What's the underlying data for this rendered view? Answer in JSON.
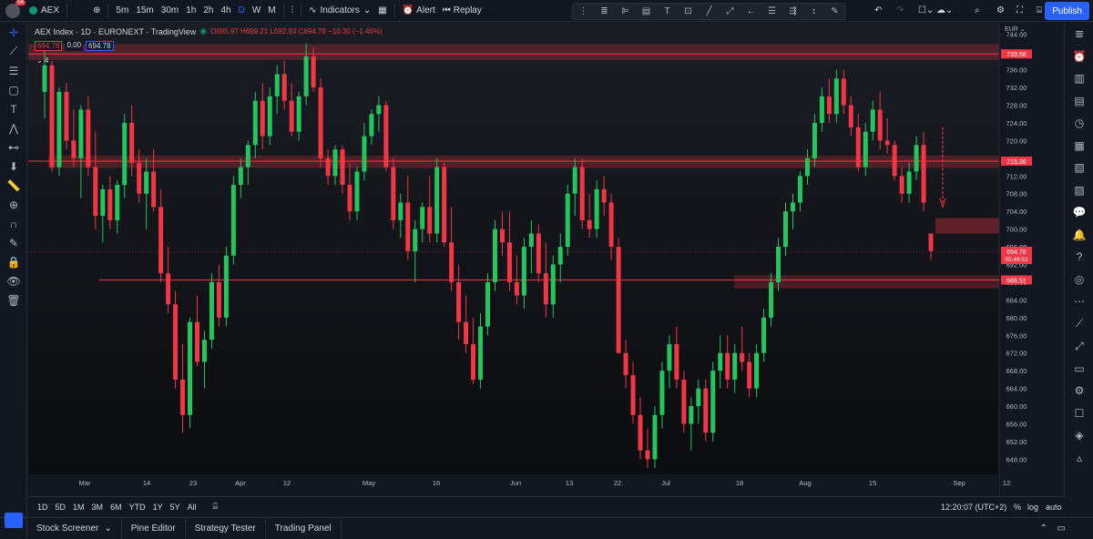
{
  "toolbar": {
    "avatar_badge": "54",
    "symbol": "AEX",
    "intervals": [
      "5m",
      "15m",
      "30m",
      "1h",
      "2h",
      "4h",
      "D",
      "W",
      "M"
    ],
    "active_interval": "D",
    "indicators_label": "Indicators",
    "alert_label": "Alert",
    "replay_label": "Replay",
    "publish_label": "Publish"
  },
  "legend": {
    "title": "AEX Index · 1D · EURONEXT · TradingView",
    "ohlc": "O695.97 H699.21 L692.93 C694.78 −10.30 (−1.46%)",
    "price_red": "694.78",
    "change": "0.00",
    "price_blue": "694.78",
    "collapse": "⌄ 4"
  },
  "currency": "EUR",
  "colors": {
    "up": "#22c55e",
    "down": "#f23645",
    "zone": "#f23645",
    "accent": "#2962ff"
  },
  "time_axis": [
    "Mar",
    "14",
    "23",
    "Apr",
    "12",
    "May",
    "16",
    "Jun",
    "13",
    "22",
    "Jul",
    "18",
    "Aug",
    "15",
    "Sep",
    "12"
  ],
  "clock": "12:20:07 (UTC+2)",
  "ranges": [
    "1D",
    "5D",
    "1M",
    "3M",
    "6M",
    "YTD",
    "1Y",
    "5Y",
    "All"
  ],
  "axis_opts": [
    "%",
    "log",
    "auto"
  ],
  "bottom_tabs": [
    "Stock Screener",
    "Pine Editor",
    "Strategy Tester",
    "Trading Panel"
  ],
  "chart_data": {
    "type": "candlestick",
    "ylim": [
      645,
      746
    ],
    "yticks": [
      744,
      740,
      736,
      732,
      728,
      724,
      720,
      716,
      712,
      708,
      704,
      700,
      696,
      692,
      688,
      684,
      680,
      676,
      672,
      668,
      664,
      660,
      656,
      652,
      648
    ],
    "levels": [
      {
        "label": "739.58",
        "value": 739.58,
        "zone": [
          738.2,
          741.8
        ]
      },
      {
        "label": "715.36",
        "value": 715.36,
        "zone": [
          713.8,
          716.6
        ]
      },
      {
        "label": "688.51",
        "value": 688.51,
        "zone": [
          686.6,
          689.6
        ]
      }
    ],
    "last_price": "694.78",
    "countdown": "05:49:52",
    "candles": [
      [
        731,
        742,
        725,
        737
      ],
      [
        737,
        738,
        713,
        714
      ],
      [
        714,
        732,
        712,
        731
      ],
      [
        731,
        733,
        718,
        720
      ],
      [
        720,
        727,
        714,
        716
      ],
      [
        716,
        728,
        707,
        727
      ],
      [
        727,
        730,
        712,
        714
      ],
      [
        714,
        722,
        700,
        703
      ],
      [
        703,
        710,
        697,
        709
      ],
      [
        709,
        712,
        700,
        702
      ],
      [
        702,
        711,
        699,
        710
      ],
      [
        710,
        726,
        707,
        724
      ],
      [
        724,
        728,
        712,
        715
      ],
      [
        715,
        718,
        706,
        708
      ],
      [
        708,
        716,
        700,
        713
      ],
      [
        713,
        718,
        704,
        705
      ],
      [
        705,
        709,
        688,
        690
      ],
      [
        690,
        696,
        681,
        683
      ],
      [
        683,
        686,
        664,
        666
      ],
      [
        666,
        674,
        654,
        658
      ],
      [
        658,
        680,
        655,
        679
      ],
      [
        679,
        685,
        669,
        670
      ],
      [
        670,
        677,
        664,
        675
      ],
      [
        675,
        690,
        673,
        688
      ],
      [
        688,
        692,
        678,
        680
      ],
      [
        680,
        696,
        678,
        694
      ],
      [
        694,
        712,
        692,
        710
      ],
      [
        710,
        716,
        707,
        714
      ],
      [
        714,
        720,
        710,
        719
      ],
      [
        719,
        731,
        716,
        729
      ],
      [
        729,
        733,
        718,
        721
      ],
      [
        721,
        732,
        719,
        730
      ],
      [
        730,
        737,
        726,
        735
      ],
      [
        735,
        738,
        727,
        729
      ],
      [
        729,
        733,
        721,
        722
      ],
      [
        722,
        731,
        720,
        730
      ],
      [
        730,
        742,
        728,
        739
      ],
      [
        739,
        741,
        731,
        732
      ],
      [
        732,
        734,
        714,
        716
      ],
      [
        716,
        718,
        710,
        712
      ],
      [
        712,
        719,
        710,
        718
      ],
      [
        718,
        719,
        708,
        710
      ],
      [
        710,
        715,
        702,
        704
      ],
      [
        704,
        714,
        702,
        713
      ],
      [
        713,
        724,
        711,
        721
      ],
      [
        721,
        727,
        719,
        726
      ],
      [
        726,
        730,
        722,
        728
      ],
      [
        728,
        729,
        713,
        714
      ],
      [
        714,
        716,
        700,
        702
      ],
      [
        702,
        708,
        698,
        706
      ],
      [
        706,
        712,
        693,
        695
      ],
      [
        695,
        702,
        688,
        700
      ],
      [
        700,
        706,
        697,
        705
      ],
      [
        705,
        712,
        697,
        699
      ],
      [
        699,
        716,
        697,
        714
      ],
      [
        714,
        715,
        696,
        697
      ],
      [
        697,
        705,
        686,
        688
      ],
      [
        688,
        692,
        675,
        679
      ],
      [
        679,
        685,
        672,
        674
      ],
      [
        674,
        680,
        665,
        666
      ],
      [
        666,
        681,
        664,
        678
      ],
      [
        678,
        690,
        676,
        688
      ],
      [
        688,
        702,
        686,
        700
      ],
      [
        700,
        704,
        694,
        697
      ],
      [
        697,
        704,
        686,
        688
      ],
      [
        688,
        694,
        683,
        685
      ],
      [
        685,
        698,
        682,
        696
      ],
      [
        696,
        702,
        690,
        699
      ],
      [
        699,
        701,
        688,
        690
      ],
      [
        690,
        697,
        680,
        683
      ],
      [
        683,
        694,
        680,
        692
      ],
      [
        692,
        699,
        688,
        696
      ],
      [
        696,
        710,
        694,
        708
      ],
      [
        708,
        716,
        703,
        714
      ],
      [
        714,
        716,
        700,
        702
      ],
      [
        702,
        708,
        698,
        700
      ],
      [
        700,
        711,
        698,
        709
      ],
      [
        709,
        712,
        703,
        706
      ],
      [
        706,
        708,
        693,
        696
      ],
      [
        696,
        698,
        676,
        672
      ],
      [
        672,
        675,
        664,
        667
      ],
      [
        667,
        670,
        656,
        658
      ],
      [
        658,
        662,
        648,
        650
      ],
      [
        650,
        655,
        646,
        648
      ],
      [
        648,
        660,
        646,
        658
      ],
      [
        658,
        670,
        655,
        668
      ],
      [
        668,
        676,
        664,
        674
      ],
      [
        674,
        678,
        664,
        666
      ],
      [
        666,
        668,
        654,
        656
      ],
      [
        656,
        662,
        650,
        660
      ],
      [
        660,
        666,
        656,
        664
      ],
      [
        664,
        666,
        652,
        654
      ],
      [
        654,
        670,
        652,
        668
      ],
      [
        668,
        676,
        664,
        672
      ],
      [
        672,
        676,
        664,
        666
      ],
      [
        666,
        674,
        663,
        672
      ],
      [
        672,
        678,
        668,
        670
      ],
      [
        670,
        672,
        662,
        664
      ],
      [
        664,
        674,
        662,
        672
      ],
      [
        672,
        682,
        670,
        680
      ],
      [
        680,
        690,
        678,
        688
      ],
      [
        688,
        698,
        686,
        696
      ],
      [
        696,
        706,
        694,
        704
      ],
      [
        704,
        708,
        700,
        706
      ],
      [
        706,
        713,
        704,
        712
      ],
      [
        712,
        718,
        710,
        716
      ],
      [
        716,
        726,
        714,
        724
      ],
      [
        724,
        732,
        722,
        730
      ],
      [
        730,
        734,
        724,
        726
      ],
      [
        726,
        736,
        724,
        734
      ],
      [
        734,
        736,
        726,
        728
      ],
      [
        728,
        730,
        721,
        723
      ],
      [
        723,
        726,
        713,
        714
      ],
      [
        714,
        724,
        712,
        722
      ],
      [
        722,
        729,
        720,
        727
      ],
      [
        727,
        731,
        718,
        720
      ],
      [
        720,
        725,
        717,
        719
      ],
      [
        719,
        720,
        711,
        712
      ],
      [
        712,
        714,
        706,
        708
      ],
      [
        708,
        715,
        706,
        713
      ],
      [
        713,
        721,
        711,
        719
      ],
      [
        719,
        722,
        704,
        706
      ],
      [
        699,
        699,
        693,
        695
      ]
    ]
  }
}
